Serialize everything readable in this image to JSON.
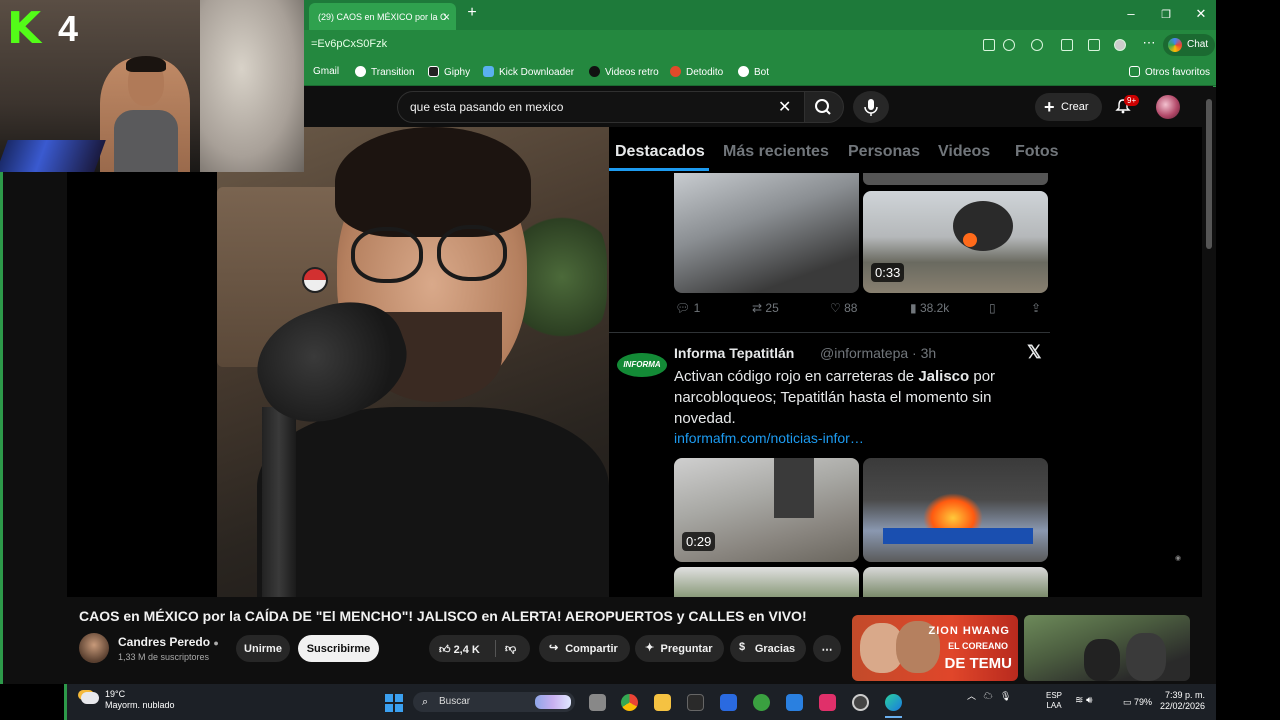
{
  "browser": {
    "tab_title": "(29) CAOS en MÉXICO por la C",
    "url": "=Ev6pCxS0Fzk",
    "chat_label": "Chat",
    "bookmarks": [
      "Gmail",
      "Transition",
      "Giphy",
      "Kick Downloader",
      "Videos retro",
      "Detodito",
      "Bot"
    ],
    "other_favorites": "Otros favoritos"
  },
  "youtube": {
    "search_value": "que esta pasando en mexico",
    "create_label": "Crear",
    "notification_badge": "9+"
  },
  "twitter_panel": {
    "tabs": [
      "Destacados",
      "Más recientes",
      "Personas",
      "Videos",
      "Fotos"
    ],
    "video1_duration": "0:33",
    "actions": {
      "replies": "1",
      "retweets": "25",
      "likes": "88",
      "views": "38.2k"
    },
    "post": {
      "user": "Informa Tepatitlán",
      "handle": "@informatepa · 3h",
      "text_before": "Activan código rojo en carreteras de ",
      "text_bold": "Jalisco",
      "text_after": " por narcobloqueos; Tepatitlán hasta el momento sin novedad.",
      "link": "informafm.com/noticias-infor…",
      "logo_text": "INFORMA",
      "video_duration": "0:29"
    }
  },
  "video_info": {
    "title": "CAOS en MÉXICO por la CAÍDA DE \"El MENCHO\"! JALISCO en ALERTA! AEROPUERTOS y CALLES en VIVO!",
    "channel": "Candres Peredo",
    "subscribers": "1,33 M de suscriptores",
    "join": "Unirme",
    "subscribe": "Suscribirme",
    "likes": "2,4 K",
    "share": "Compartir",
    "ask": "Preguntar",
    "thanks": "Gracias"
  },
  "suggestion1": {
    "line1": "ZION",
    "line2": "HWANG",
    "line3": "EL COREANO",
    "line4": "DE TEMU"
  },
  "taskbar": {
    "temp": "19°C",
    "weather": "Mayorm. nublado",
    "search": "Buscar",
    "lang1": "ESP",
    "lang2": "LAA",
    "battery": "79%",
    "time": "7:39 p. m.",
    "date": "22/02/2026"
  },
  "overlay": {
    "kick_letter": "K",
    "kick_number": "4"
  }
}
